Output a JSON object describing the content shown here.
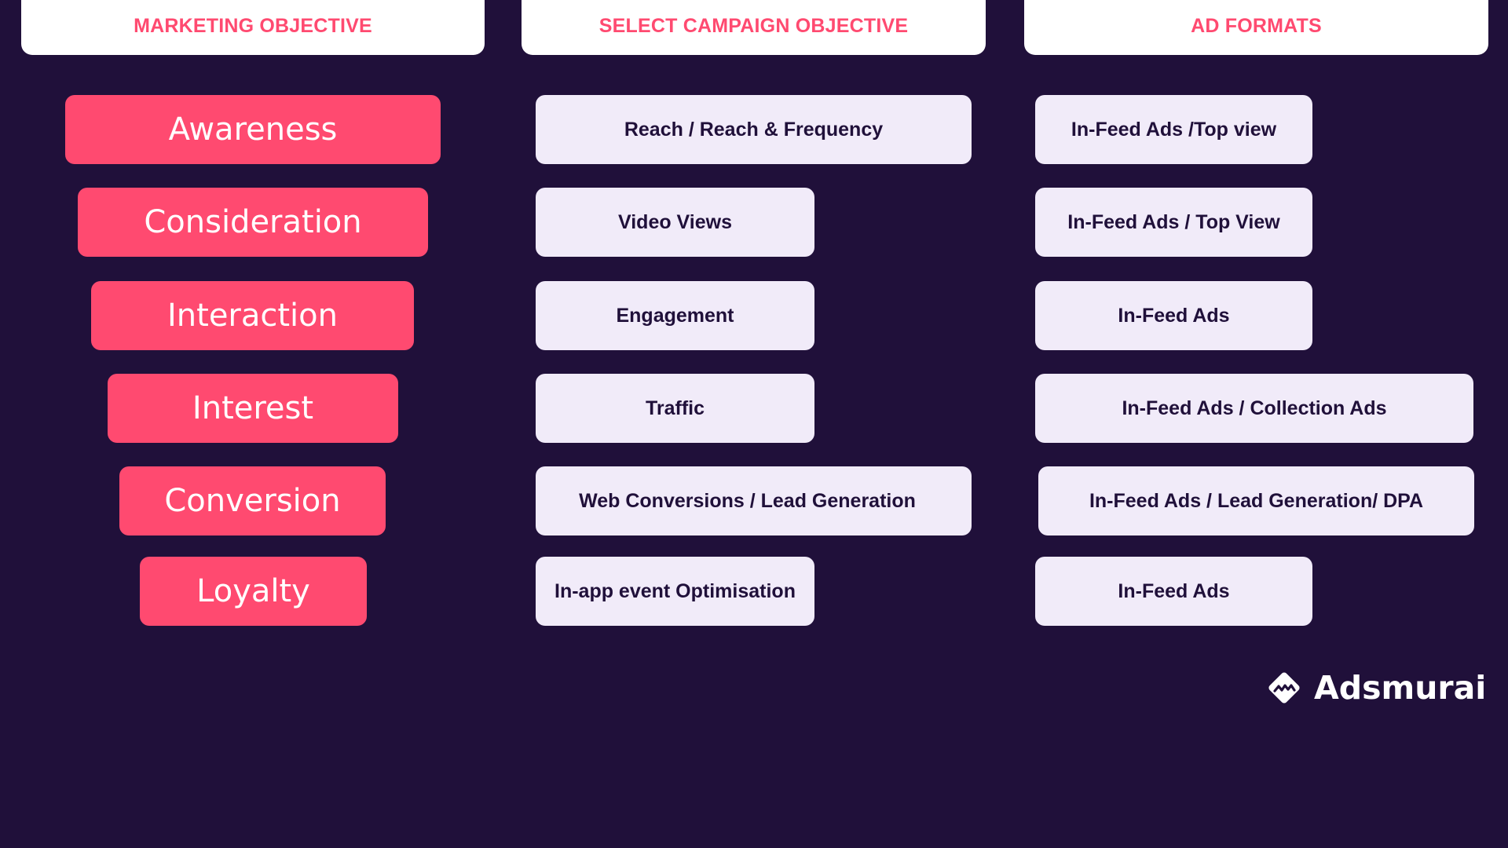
{
  "colors": {
    "background": "#20103a",
    "accent_pink": "#ff4a70",
    "header_bg": "#ffffff",
    "light_box": "#f1ebf9",
    "dark_text": "#20103a"
  },
  "headers": {
    "marketing_objective": "MARKETING OBJECTIVE",
    "campaign_objective": "SELECT CAMPAIGN OBJECTIVE",
    "ad_formats": "AD FORMATS"
  },
  "rows": [
    {
      "marketing": "Awareness",
      "campaign": "Reach / Reach & Frequency",
      "ad_format": "In-Feed Ads /Top view"
    },
    {
      "marketing": "Consideration",
      "campaign": "Video Views",
      "ad_format": "In-Feed Ads / Top View"
    },
    {
      "marketing": "Interaction",
      "campaign": "Engagement",
      "ad_format": "In-Feed Ads"
    },
    {
      "marketing": "Interest",
      "campaign": "Traffic",
      "ad_format": "In-Feed Ads / Collection Ads"
    },
    {
      "marketing": "Conversion",
      "campaign": "Web Conversions / Lead Generation",
      "ad_format": "In-Feed Ads / Lead Generation/ DPA"
    },
    {
      "marketing": "Loyalty",
      "campaign": "In-app event Optimisation",
      "ad_format": "In-Feed Ads"
    }
  ],
  "logo": {
    "icon": "adsmurai-diamond-icon",
    "text": "Adsmurai"
  }
}
